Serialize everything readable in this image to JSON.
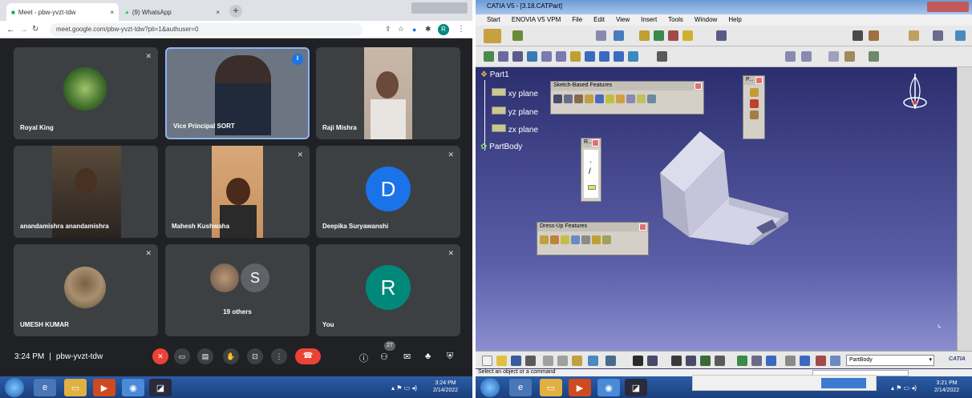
{
  "browser": {
    "tabs": [
      {
        "label": "Meet - pbw-yvzt-tdw"
      },
      {
        "label": "(9) WhatsApp"
      }
    ],
    "url": "meet.google.com/pbw-yvzt-tdw?pli=1&authuser=0",
    "profile_initial": "R"
  },
  "meet": {
    "tiles": [
      {
        "name": "Royal King"
      },
      {
        "name": "Vice Principal SORT"
      },
      {
        "name": "Raji Mishra"
      },
      {
        "name": "anandamishra anandamishra"
      },
      {
        "name": "Mahesh Kushwaha"
      },
      {
        "name": "Deepika Suryawanshi",
        "initial": "D"
      },
      {
        "name": "UMESH KUMAR"
      },
      {
        "name": "19 others",
        "initial": "S"
      },
      {
        "name": "You",
        "initial": "R"
      }
    ],
    "time": "3:24 PM",
    "separator": "|",
    "meeting_code": "pbw-yvzt-tdw",
    "participant_count": "27"
  },
  "taskbar_left": {
    "time": "3:24 PM",
    "date": "2/14/2022"
  },
  "catia": {
    "title": "CATIA V5 - [3.18.CATPart]",
    "menu": [
      "Start",
      "ENOVIA V5 VPM",
      "File",
      "Edit",
      "View",
      "Insert",
      "Tools",
      "Window",
      "Help"
    ],
    "tree": {
      "root": "Part1",
      "planes": [
        "xy plane",
        "yz plane",
        "zx plane"
      ],
      "body": "PartBody"
    },
    "panels": {
      "sketch_based": "Sketch-Based Features",
      "dress_up": "Dress-Up Features",
      "small1": "P...",
      "small2": "R..."
    },
    "part_body_select": "PartBody",
    "status": "Select an object or a command",
    "logo": "CATIA"
  },
  "taskbar_right": {
    "time": "3:21 PM",
    "date": "2/14/2022"
  },
  "colors": {
    "meet_bg": "#202124",
    "tile_bg": "#3c4043",
    "end_call": "#ea4335",
    "deepika": "#1a73e8",
    "you": "#00897b",
    "catia_bg": "#3a3a78"
  }
}
